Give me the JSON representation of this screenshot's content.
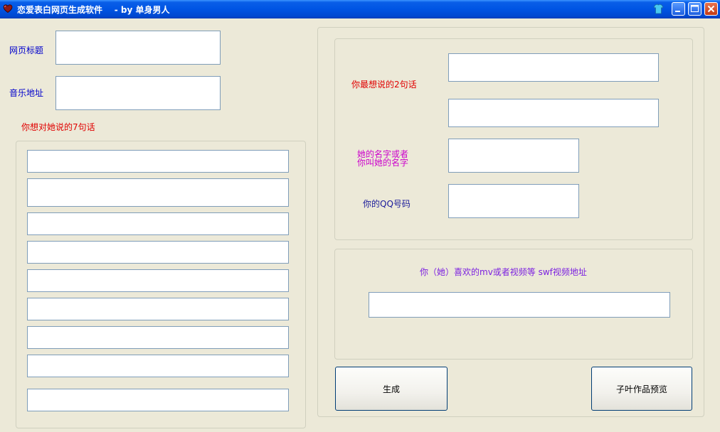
{
  "window": {
    "title": "恋爱表白网页生成软件    - by 单身男人"
  },
  "left": {
    "page_title_label": "网页标题",
    "music_url_label": "音乐地址",
    "seven_sentences_label": "你想对她说的7句话"
  },
  "right": {
    "two_sentences_label": "你最想说的2句话",
    "her_name_label_line1": "她的名字或者",
    "her_name_label_line2": "你叫她的名字",
    "qq_label": "你的QQ号码",
    "video_label": "你（她）喜欢的mv或者视频等 swf视频地址"
  },
  "buttons": {
    "generate": "生成",
    "preview": "子叶作品预览"
  }
}
